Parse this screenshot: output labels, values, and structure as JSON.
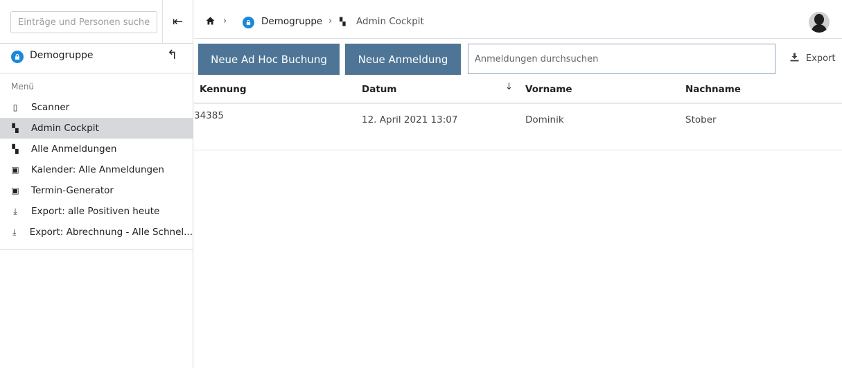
{
  "sidebar": {
    "search_placeholder": "Einträge und Personen suchen",
    "collapse_icon": "collapse-left-icon",
    "group": {
      "label": "Demogruppe",
      "icon": "lock-icon",
      "up_icon": "arrow-up-icon"
    },
    "menu_heading": "Menü",
    "menu_items": [
      {
        "label": "Scanner",
        "icon": "phone-icon",
        "active": false
      },
      {
        "label": "Admin Cockpit",
        "icon": "dashboard-icon",
        "active": true
      },
      {
        "label": "Alle Anmeldungen",
        "icon": "dashboard-icon",
        "active": false
      },
      {
        "label": "Kalender: Alle Anmeldungen",
        "icon": "calendar-icon",
        "active": false
      },
      {
        "label": "Termin-Generator",
        "icon": "calendar-icon",
        "active": false
      },
      {
        "label": "Export: alle Positiven heute",
        "icon": "download-icon",
        "active": false
      },
      {
        "label": "Export: Abrechnung - Alle Schnel...",
        "icon": "download-icon",
        "active": false
      }
    ]
  },
  "breadcrumb": {
    "home_icon": "home-icon",
    "group": "Demogruppe",
    "current": "Admin Cockpit"
  },
  "toolbar": {
    "adhoc_label": "Neue Ad Hoc Buchung",
    "anmeldung_label": "Neue Anmeldung",
    "search_placeholder": "Anmeldungen durchsuchen",
    "export_label": "Export"
  },
  "table": {
    "columns": [
      "Kennung",
      "Datum",
      "Vorname",
      "Nachname"
    ],
    "sorted_column": "Datum",
    "rows": [
      {
        "kennung": "34385",
        "datum": "12. April 2021 13:07",
        "vorname": "Dominik",
        "nachname": "Stober"
      }
    ]
  },
  "colors": {
    "primary_button": "#4e7595",
    "group_icon": "#1a88d8",
    "active_menu": "#d6d8dc"
  }
}
